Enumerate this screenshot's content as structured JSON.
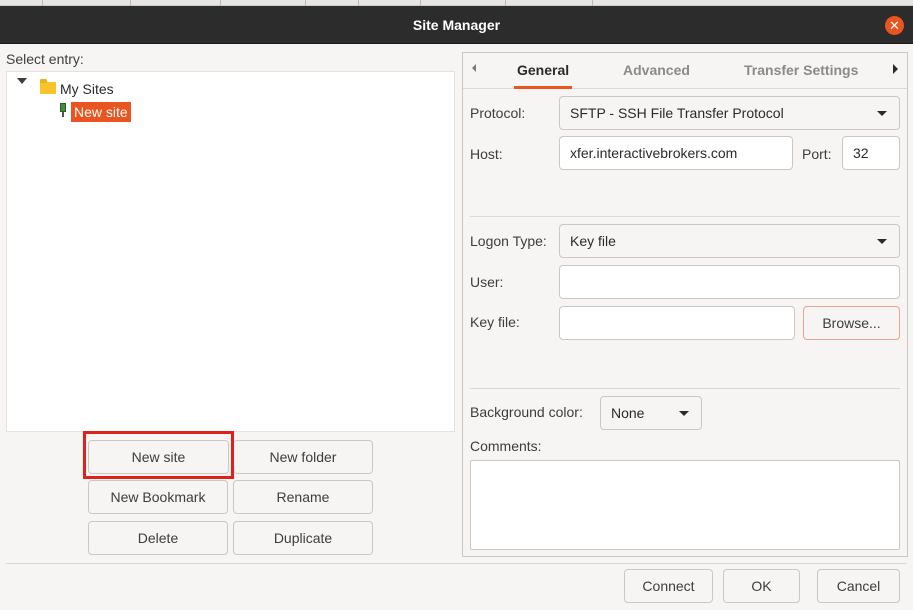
{
  "window": {
    "title": "Site Manager"
  },
  "left": {
    "select_label": "Select entry:",
    "tree": {
      "root_label": "My Sites",
      "selected_site": "New site"
    },
    "buttons": {
      "new_site": "New site",
      "new_folder": "New folder",
      "new_bookmark": "New Bookmark",
      "rename": "Rename",
      "delete": "Delete",
      "duplicate": "Duplicate"
    }
  },
  "tabs": {
    "items": [
      "General",
      "Advanced",
      "Transfer Settings"
    ],
    "active": "General"
  },
  "general": {
    "protocol_label": "Protocol:",
    "protocol_value": "SFTP - SSH File Transfer Protocol",
    "host_label": "Host:",
    "host_value": "xfer.interactivebrokers.com",
    "port_label": "Port:",
    "port_value": "32",
    "logon_type_label": "Logon Type:",
    "logon_type_value": "Key file",
    "user_label": "User:",
    "user_value": "",
    "key_file_label": "Key file:",
    "key_file_value": "",
    "browse_label": "Browse...",
    "background_color_label": "Background color:",
    "background_color_value": "None",
    "comments_label": "Comments:",
    "comments_value": ""
  },
  "footer": {
    "connect": "Connect",
    "ok": "OK",
    "cancel": "Cancel"
  },
  "colors": {
    "accent": "#e95420",
    "titlebar": "#2c2c2c",
    "highlight_box": "#e0201b"
  },
  "icons": {
    "close": "close-icon",
    "folder": "folder-icon",
    "site": "server-icon",
    "expand": "chevron-down-icon"
  }
}
